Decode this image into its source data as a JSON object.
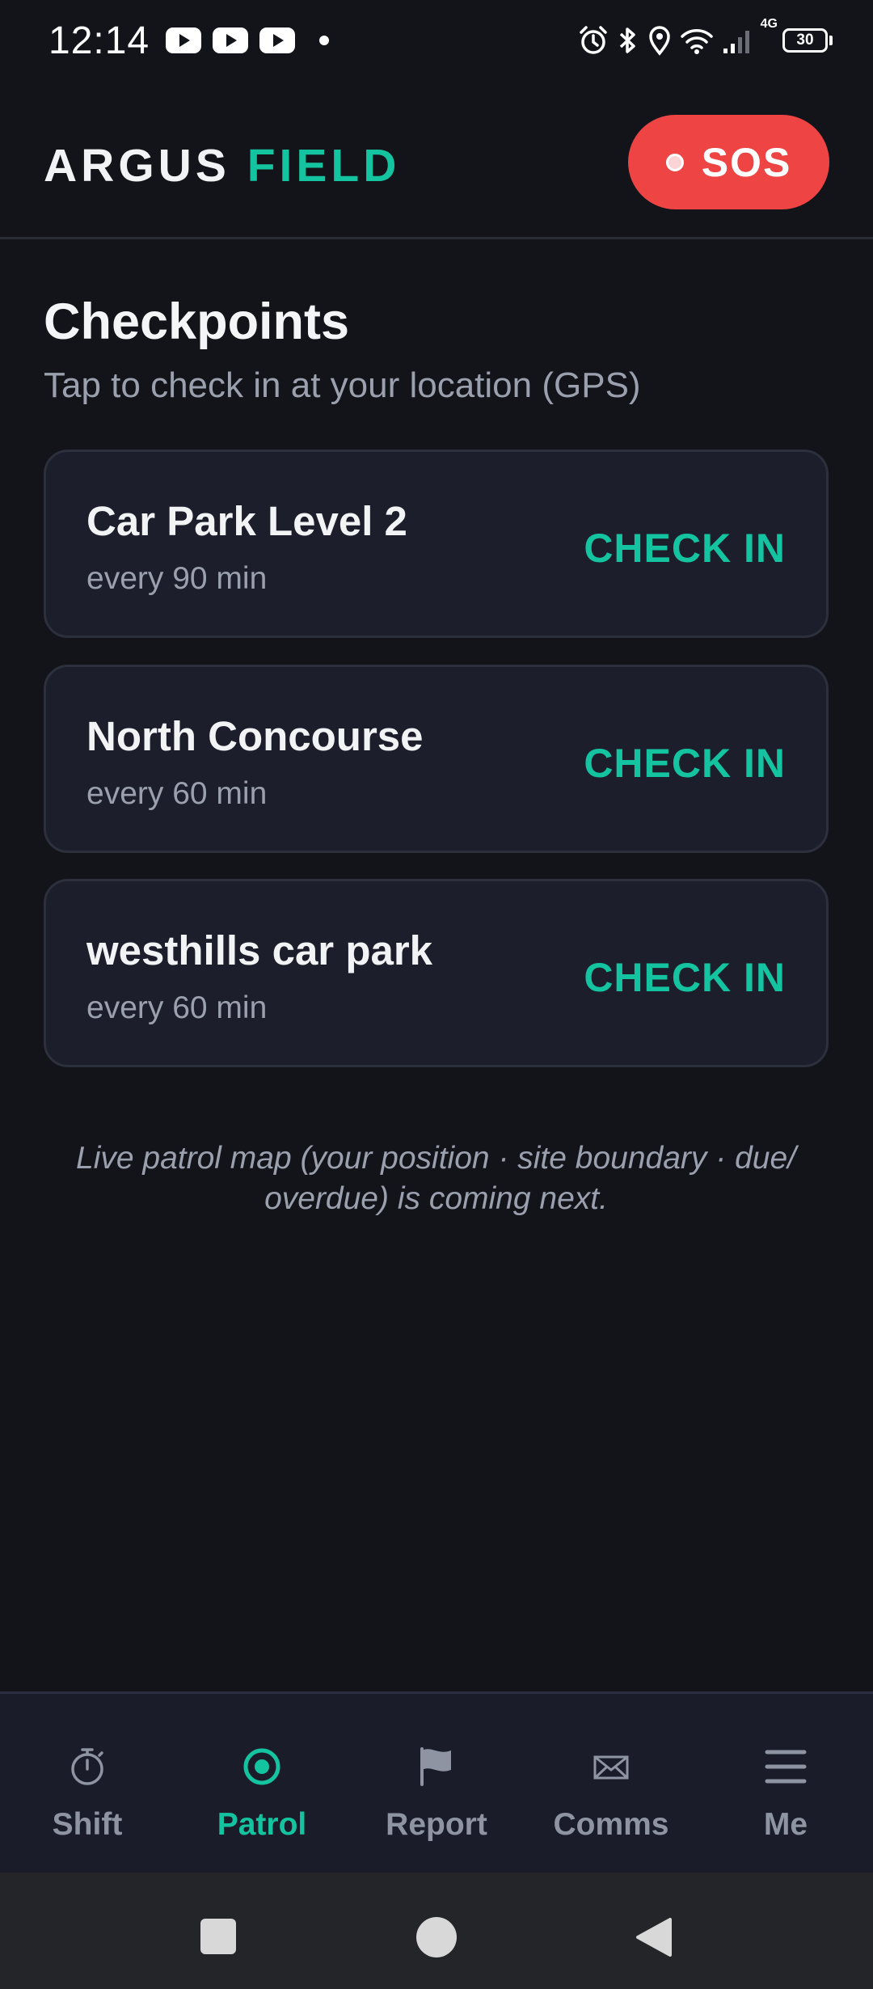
{
  "status_bar": {
    "time": "12:14",
    "network": "4G",
    "battery": "30",
    "icons": [
      "youtube-icon",
      "youtube-icon",
      "youtube-icon",
      "notification-dot",
      "alarm-icon",
      "bluetooth-icon",
      "location-icon",
      "wifi-icon",
      "signal-icon",
      "battery-icon"
    ]
  },
  "header": {
    "brand_part1": "ARGUS",
    "brand_part2": "FIELD",
    "sos_label": "SOS"
  },
  "page": {
    "title": "Checkpoints",
    "subtitle": "Tap to check in at your location (GPS)"
  },
  "checkpoints": [
    {
      "name": "Car Park Level 2",
      "frequency": "every 90 min",
      "action": "CHECK IN"
    },
    {
      "name": "North Concourse",
      "frequency": "every 60 min",
      "action": "CHECK IN"
    },
    {
      "name": "westhills car park",
      "frequency": "every 60 min",
      "action": "CHECK IN"
    }
  ],
  "note": "Live patrol map (your position · site boundary · due/ overdue) is coming next.",
  "bottom_nav": [
    {
      "label": "Shift",
      "icon": "stopwatch-icon",
      "active": false
    },
    {
      "label": "Patrol",
      "icon": "target-icon",
      "active": true
    },
    {
      "label": "Report",
      "icon": "flag-icon",
      "active": false
    },
    {
      "label": "Comms",
      "icon": "envelope-icon",
      "active": false
    },
    {
      "label": "Me",
      "icon": "menu-icon",
      "active": false
    }
  ],
  "colors": {
    "background": "#13141a",
    "accent": "#14c4a0",
    "sos": "#ef4444",
    "card": "#1c1f2b",
    "muted": "#9aa0ad"
  }
}
